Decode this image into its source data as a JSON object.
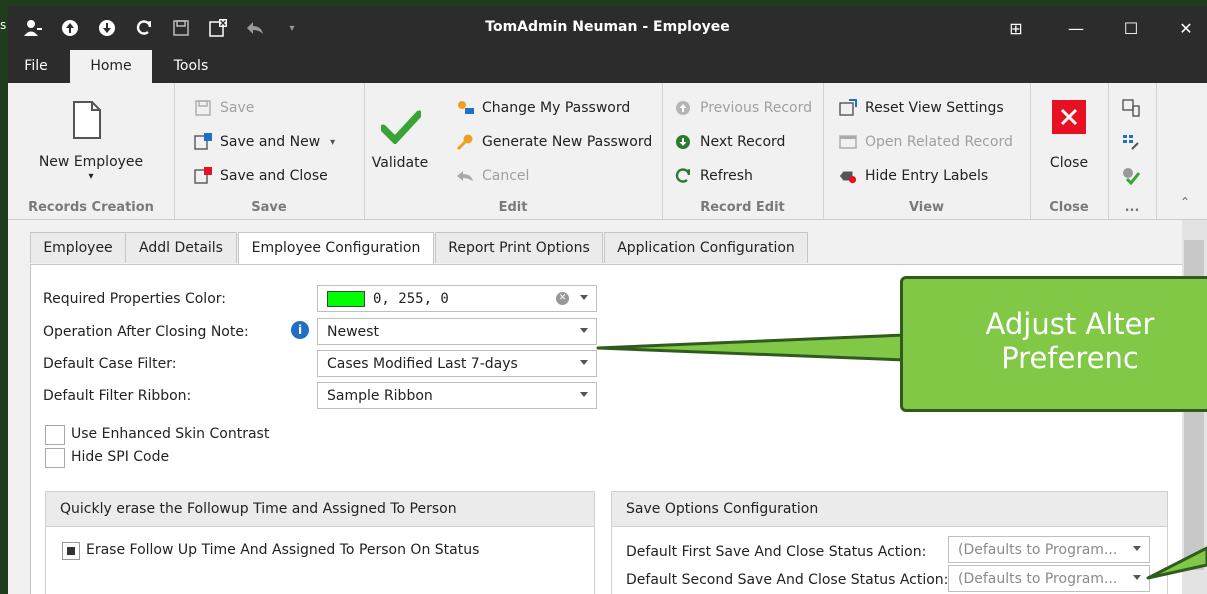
{
  "window": {
    "title": "TomAdmin Neuman - Employee",
    "left_edge_char": "s"
  },
  "qat_icons": [
    "user-plus-icon",
    "up-circle-icon",
    "down-circle-icon",
    "refresh-icon",
    "save-icon",
    "save-close-icon",
    "undo-icon",
    "dropdown-icon"
  ],
  "window_buttons": {
    "restore_glyph": "⊞",
    "minimize_glyph": "—",
    "maximize_glyph": "☐",
    "close_glyph": "✕"
  },
  "menu": {
    "file": "File",
    "home": "Home",
    "tools": "Tools"
  },
  "ribbon": {
    "records_creation": {
      "caption": "Records Creation",
      "new_employee": "New Employee"
    },
    "save": {
      "caption": "Save",
      "save": "Save",
      "save_and_new": "Save and New",
      "save_and_close": "Save and Close"
    },
    "edit": {
      "caption": "Edit",
      "validate": "Validate",
      "change_password": "Change My Password",
      "generate_password": "Generate New Password",
      "cancel": "Cancel"
    },
    "record_edit": {
      "caption": "Record Edit",
      "previous": "Previous Record",
      "next": "Next Record",
      "refresh": "Refresh"
    },
    "view": {
      "caption": "View",
      "reset": "Reset View Settings",
      "open_related": "Open Related Record",
      "hide_labels": "Hide Entry Labels"
    },
    "close": {
      "caption": "Close",
      "close": "Close"
    },
    "more": {
      "caption": "..."
    }
  },
  "tabs": [
    "Employee",
    "Addl Details",
    "Employee Configuration",
    "Report Print Options",
    "Application Configuration"
  ],
  "form": {
    "required_color_label": "Required Properties Color:",
    "required_color_value": "0, 255, 0",
    "required_color_swatch": "#00ff00",
    "operation_label": "Operation After Closing Note:",
    "operation_value": "Newest",
    "case_filter_label": "Default Case Filter:",
    "case_filter_value": "Cases Modified Last 7-days",
    "filter_ribbon_label": "Default Filter Ribbon:",
    "filter_ribbon_value": "Sample Ribbon",
    "enhanced_contrast": "Use Enhanced Skin Contrast",
    "hide_spi": "Hide SPI Code"
  },
  "followup_box": {
    "title": "Quickly erase the Followup Time and Assigned To Person",
    "checkbox": "Erase Follow Up Time And Assigned To Person On Status"
  },
  "save_options": {
    "title": "Save Options Configuration",
    "first_label": "Default First Save And Close Status Action:",
    "first_value": "(Defaults to Program...",
    "second_label": "Default Second Save And Close Status Action:",
    "second_value": "(Defaults to Program..."
  },
  "callout": {
    "line1": "Adjust Alter",
    "line2": "Preferenc"
  },
  "colors": {
    "titlebar": "#2c2c2c",
    "callout": "#80c846",
    "validate": "#3aa336",
    "close_red": "#e81123",
    "info_blue": "#1f6fc5"
  }
}
